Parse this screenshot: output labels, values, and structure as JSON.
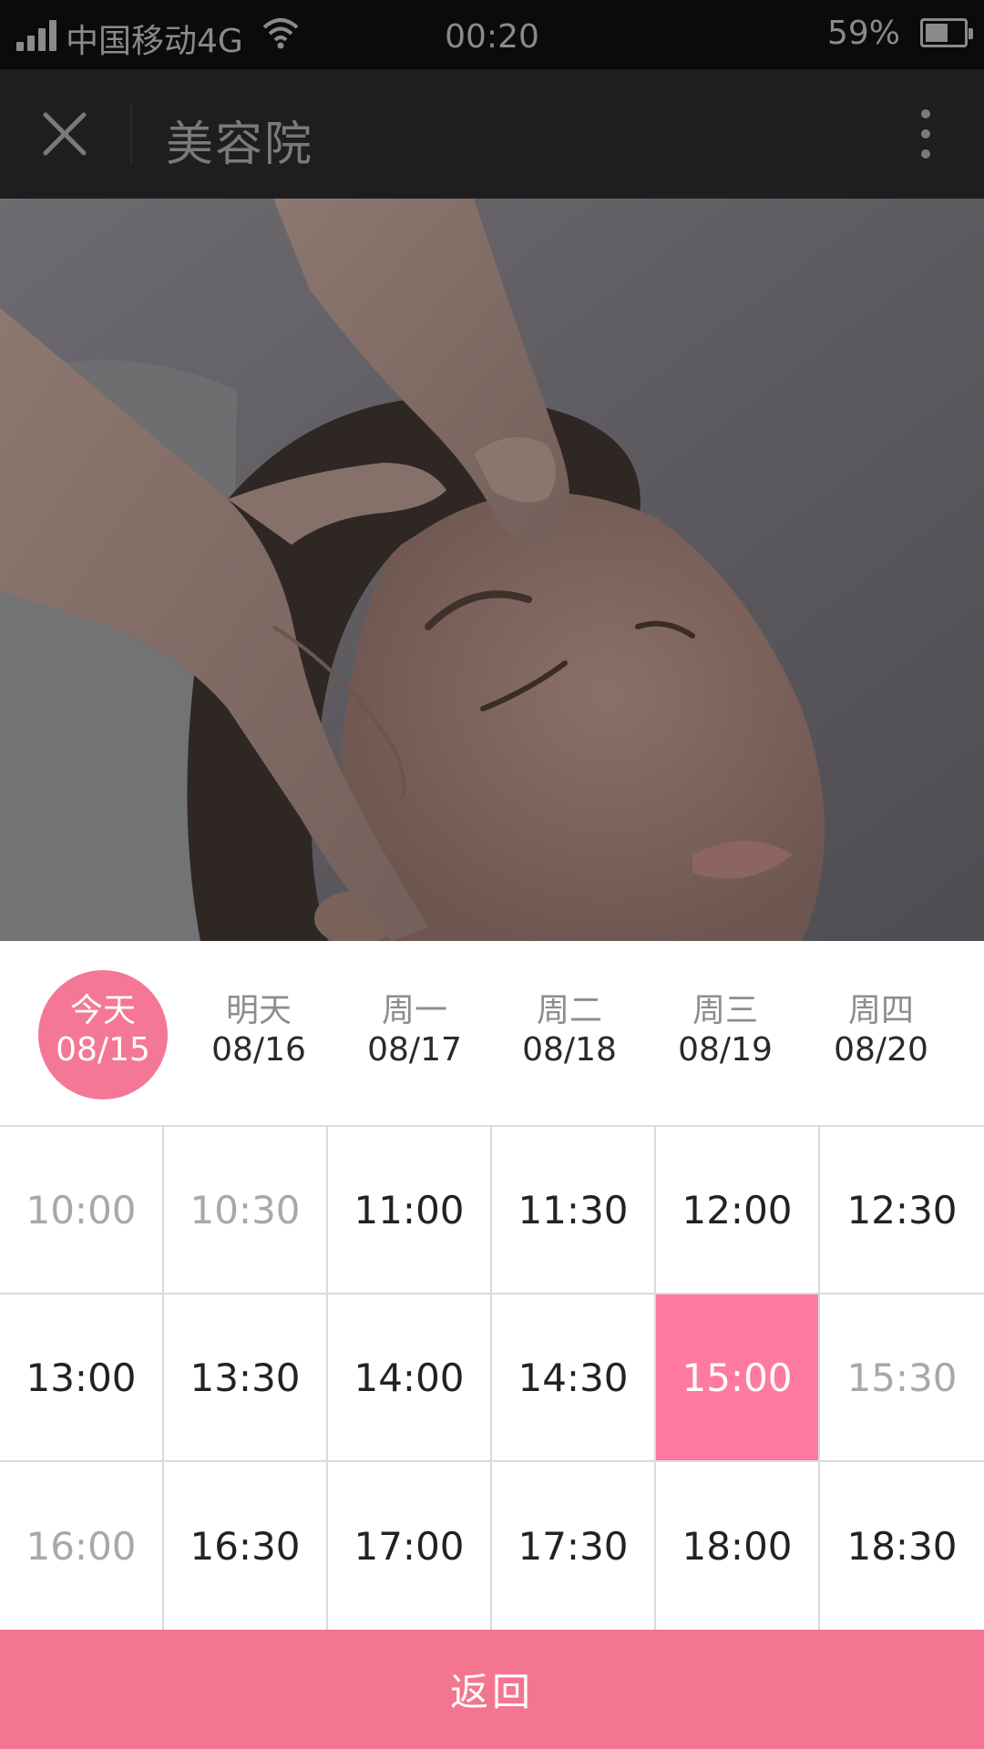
{
  "status_bar": {
    "carrier": "中国移动4G",
    "time": "00:20",
    "battery": "59%",
    "battery_level": 0.59,
    "icons": [
      "signal-icon",
      "wifi-icon",
      "battery-icon"
    ]
  },
  "header": {
    "title": "美容院",
    "icons": [
      "close-icon",
      "more-vertical-icon"
    ]
  },
  "dates": [
    {
      "day": "今天",
      "date": "08/15",
      "selected": true
    },
    {
      "day": "明天",
      "date": "08/16",
      "selected": false
    },
    {
      "day": "周一",
      "date": "08/17",
      "selected": false
    },
    {
      "day": "周二",
      "date": "08/18",
      "selected": false
    },
    {
      "day": "周三",
      "date": "08/19",
      "selected": false
    },
    {
      "day": "周四",
      "date": "08/20",
      "selected": false
    }
  ],
  "time_slots": [
    {
      "time": "10:00",
      "state": "unavailable"
    },
    {
      "time": "10:30",
      "state": "unavailable"
    },
    {
      "time": "11:00",
      "state": "available"
    },
    {
      "time": "11:30",
      "state": "available"
    },
    {
      "time": "12:00",
      "state": "available"
    },
    {
      "time": "12:30",
      "state": "available"
    },
    {
      "time": "13:00",
      "state": "available"
    },
    {
      "time": "13:30",
      "state": "available"
    },
    {
      "time": "14:00",
      "state": "available"
    },
    {
      "time": "14:30",
      "state": "available"
    },
    {
      "time": "15:00",
      "state": "selected"
    },
    {
      "time": "15:30",
      "state": "unavailable"
    },
    {
      "time": "16:00",
      "state": "unavailable"
    },
    {
      "time": "16:30",
      "state": "available"
    },
    {
      "time": "17:00",
      "state": "available"
    },
    {
      "time": "17:30",
      "state": "available"
    },
    {
      "time": "18:00",
      "state": "available"
    },
    {
      "time": "18:30",
      "state": "available"
    }
  ],
  "footer": {
    "back_label": "返回"
  },
  "colors": {
    "accent": "#f47590",
    "selected_slot": "#ff7aa0",
    "unavailable_text": "#a8a8a8",
    "header_bg": "#1e1e1f"
  }
}
